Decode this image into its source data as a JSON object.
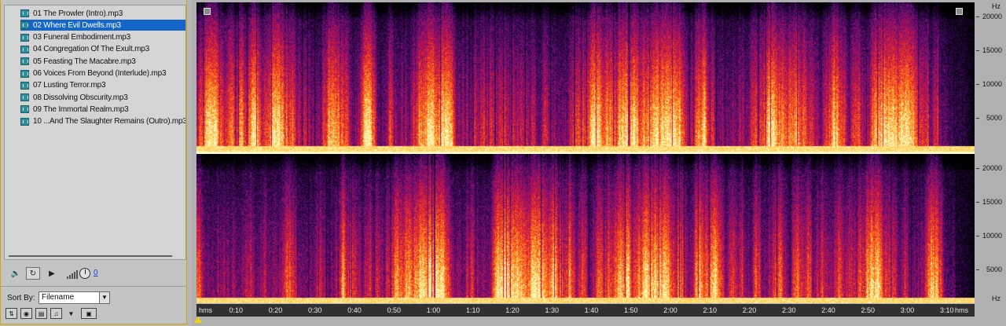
{
  "files_panel": {
    "files": [
      {
        "name": "01 The Prowler (Intro).mp3",
        "selected": false
      },
      {
        "name": "02 Where Evil Dwells.mp3",
        "selected": true
      },
      {
        "name": "03 Funeral Embodiment.mp3",
        "selected": false
      },
      {
        "name": "04 Congregation Of The Exult.mp3",
        "selected": false
      },
      {
        "name": "05 Feasting The Macabre.mp3",
        "selected": false
      },
      {
        "name": "06 Voices From Beyond (Interlude).mp3",
        "selected": false
      },
      {
        "name": "07 Lusting Terror.mp3",
        "selected": false
      },
      {
        "name": "08 Dissolving Obscurity.mp3",
        "selected": false
      },
      {
        "name": "09 The Immortal Realm.mp3",
        "selected": false
      },
      {
        "name": "10 ...And The Slaughter Remains (Outro).mp3",
        "selected": false
      }
    ],
    "volume_value": "0",
    "sort_label": "Sort By:",
    "sort_value": "Filename",
    "transport_icons": [
      "speaker-icon",
      "loop-icon",
      "play-icon",
      "volume-bars-icon",
      "volume-knob-icon"
    ],
    "bottom_icons": [
      "insert-icon",
      "auto-play-icon",
      "open-icon",
      "import-icon",
      "filter-icon",
      "close-file-icon"
    ]
  },
  "spectral_view": {
    "frequency_unit": "Hz",
    "frequency_ticks": [
      "20000",
      "15000",
      "10000",
      "5000"
    ],
    "frequency_values": [
      20000,
      15000,
      10000,
      5000
    ],
    "frequency_max": 22050,
    "time_unit": "hms",
    "time_ticks": [
      "0:10",
      "0:20",
      "0:30",
      "0:40",
      "0:50",
      "1:00",
      "1:10",
      "1:20",
      "1:30",
      "1:40",
      "1:50",
      "2:00",
      "2:10",
      "2:20",
      "2:30",
      "2:40",
      "2:50",
      "3:00",
      "3:10"
    ],
    "time_tick_seconds": [
      10,
      20,
      30,
      40,
      50,
      60,
      70,
      80,
      90,
      100,
      110,
      120,
      130,
      140,
      150,
      160,
      170,
      180,
      190
    ],
    "duration_seconds": 197,
    "channels": 2,
    "colors": {
      "low": "#000000",
      "mid_low": "#3a0a5e",
      "mid": "#c0105a",
      "high": "#ff5a10",
      "peak": "#fff4a0"
    }
  }
}
